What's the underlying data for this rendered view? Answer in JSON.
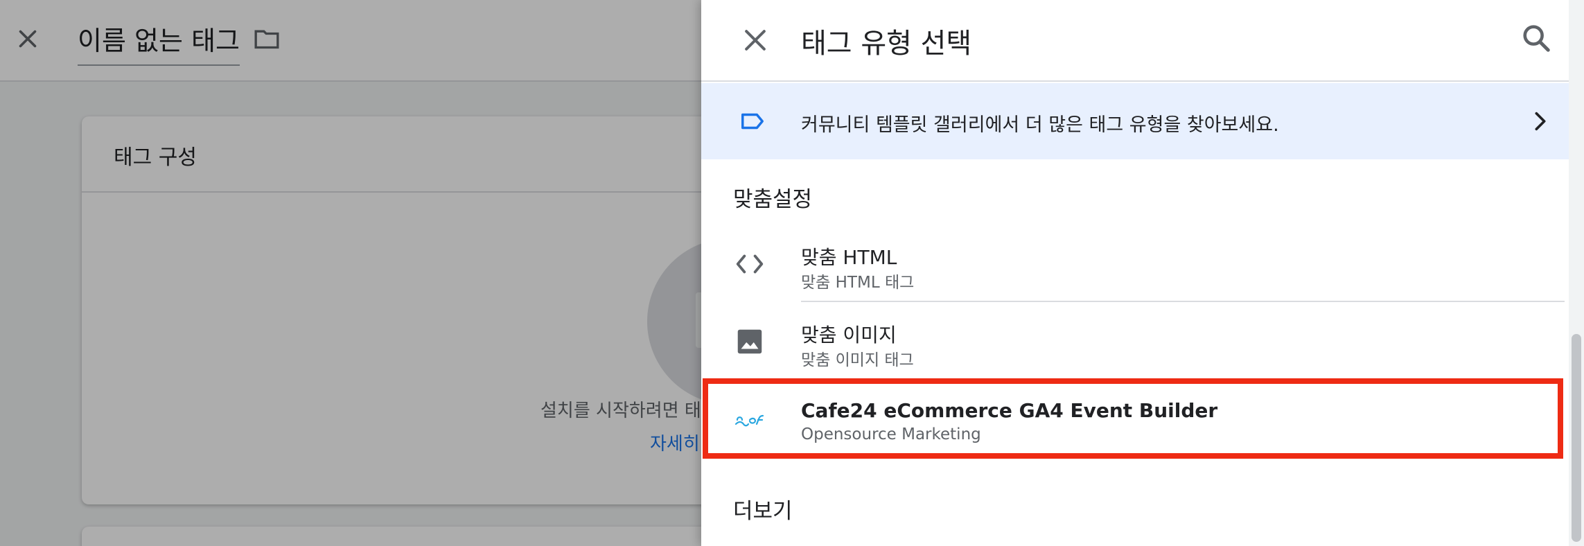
{
  "background": {
    "tag_name": "이름 없는 태그",
    "card_title": "태그 구성",
    "card_description": "설치를 시작하려면 태",
    "card_link": "자세히"
  },
  "panel": {
    "title": "태그 유형 선택",
    "banner_text": "커뮤니티 템플릿 갤러리에서 더 많은 태그 유형을 찾아보세요.",
    "section_custom": "맞춤설정",
    "items": [
      {
        "name": "맞춤 HTML",
        "sub": "맞춤 HTML 태그",
        "icon": "code-icon"
      },
      {
        "name": "맞춤 이미지",
        "sub": "맞춤 이미지 태그",
        "icon": "image-icon"
      },
      {
        "name": "Cafe24 eCommerce GA4 Event Builder",
        "sub": "Opensource Marketing",
        "icon": "cafe24-logo-icon"
      }
    ],
    "section_more": "더보기"
  },
  "colors": {
    "accent_blue": "#1a73e8",
    "banner_bg": "#e8f0fe",
    "highlight_red": "#ee2b14",
    "logo_cyan": "#2aa7e0"
  }
}
